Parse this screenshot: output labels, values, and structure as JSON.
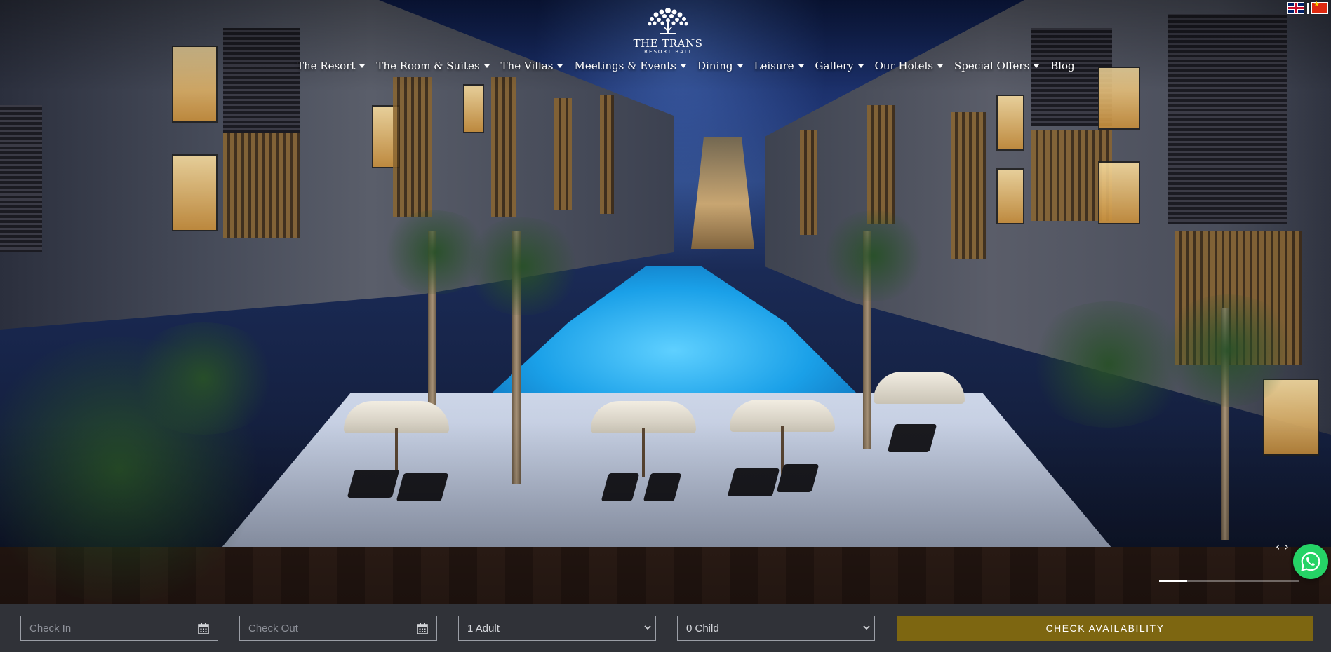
{
  "brand": {
    "name": "THE TRANS",
    "subtitle": "RESORT BALI",
    "logo_icon": "tree-of-life-icon"
  },
  "nav": {
    "items": [
      {
        "label": "The Resort",
        "has_dropdown": true
      },
      {
        "label": "The Room & Suites",
        "has_dropdown": true
      },
      {
        "label": "The Villas",
        "has_dropdown": true
      },
      {
        "label": "Meetings & Events",
        "has_dropdown": true
      },
      {
        "label": "Dining",
        "has_dropdown": true
      },
      {
        "label": "Leisure",
        "has_dropdown": true
      },
      {
        "label": "Gallery",
        "has_dropdown": true
      },
      {
        "label": "Our Hotels",
        "has_dropdown": true
      },
      {
        "label": "Special Offers",
        "has_dropdown": true
      },
      {
        "label": "Blog",
        "has_dropdown": false
      }
    ]
  },
  "languages": [
    {
      "code": "en",
      "icon": "uk-flag-icon"
    },
    {
      "code": "zh",
      "icon": "china-flag-icon"
    }
  ],
  "slider": {
    "prev_label": "‹",
    "next_label": "›",
    "progress_fraction": 0.2
  },
  "whatsapp": {
    "icon": "whatsapp-icon",
    "color": "#25d366"
  },
  "booking": {
    "check_in": {
      "placeholder": "Check In",
      "icon": "calendar-icon"
    },
    "check_out": {
      "placeholder": "Check Out",
      "icon": "calendar-icon"
    },
    "adults": {
      "value": "1 Adult"
    },
    "children": {
      "value": "0 Child"
    },
    "submit_label": "CHECK AVAILABILITY",
    "accent_color": "#7d6611",
    "bar_color": "#303238"
  }
}
